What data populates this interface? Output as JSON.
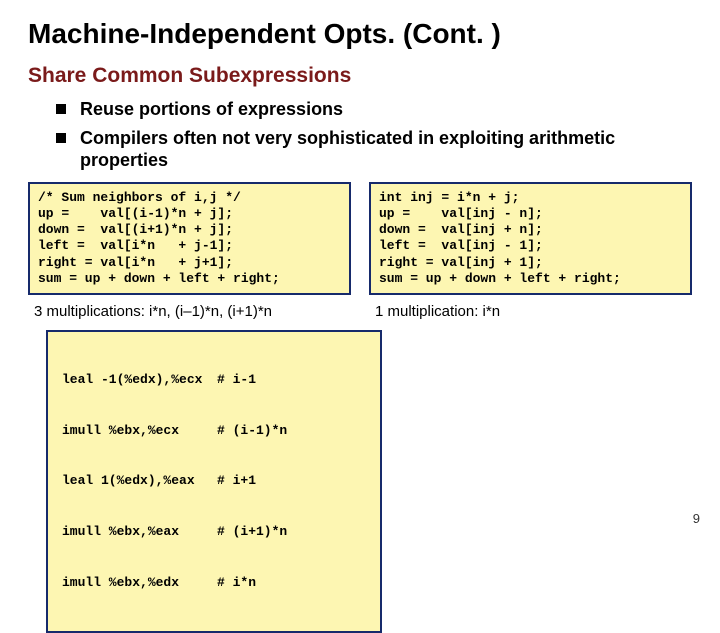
{
  "title": "Machine-Independent Opts. (Cont. )",
  "subhead": "Share Common Subexpressions",
  "bullets": [
    "Reuse portions of expressions",
    "Compilers often not very sophisticated in exploiting arithmetic properties"
  ],
  "code_left": "/* Sum neighbors of i,j */\nup =    val[(i-1)*n + j];\ndown =  val[(i+1)*n + j];\nleft =  val[i*n   + j-1];\nright = val[i*n   + j+1];\nsum = up + down + left + right;",
  "code_right": "int inj = i*n + j;\nup =    val[inj - n];\ndown =  val[inj + n];\nleft =  val[inj - 1];\nright = val[inj + 1];\nsum = up + down + left + right;",
  "caption_left": "3 multiplications: i*n, (i–1)*n, (i+1)*n",
  "caption_right": "1 multiplication: i*n",
  "asm": [
    {
      "instr": "leal -1(%edx),%ecx",
      "comment": "# i-1"
    },
    {
      "instr": "imull %ebx,%ecx",
      "comment": "# (i-1)*n"
    },
    {
      "instr": "leal 1(%edx),%eax",
      "comment": "# i+1"
    },
    {
      "instr": "imull %ebx,%eax",
      "comment": "# (i+1)*n"
    },
    {
      "instr": "imull %ebx,%edx",
      "comment": "# i*n"
    }
  ],
  "page_number": "9"
}
